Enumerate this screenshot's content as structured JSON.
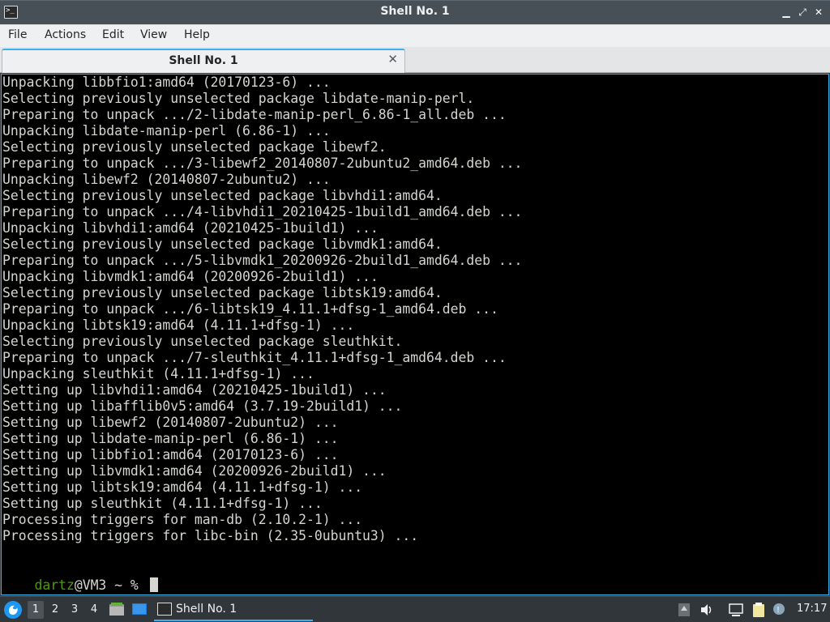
{
  "window": {
    "title": "Shell No. 1",
    "controls": {
      "minimize": "▁",
      "restore": "⤢",
      "close": "✕"
    }
  },
  "menubar": {
    "items": [
      "File",
      "Actions",
      "Edit",
      "View",
      "Help"
    ]
  },
  "tabs": [
    {
      "label": "Shell No. 1",
      "close": "✕"
    }
  ],
  "terminal": {
    "lines": [
      "Unpacking libbfio1:amd64 (20170123-6) ...",
      "Selecting previously unselected package libdate-manip-perl.",
      "Preparing to unpack .../2-libdate-manip-perl_6.86-1_all.deb ...",
      "Unpacking libdate-manip-perl (6.86-1) ...",
      "Selecting previously unselected package libewf2.",
      "Preparing to unpack .../3-libewf2_20140807-2ubuntu2_amd64.deb ...",
      "Unpacking libewf2 (20140807-2ubuntu2) ...",
      "Selecting previously unselected package libvhdi1:amd64.",
      "Preparing to unpack .../4-libvhdi1_20210425-1build1_amd64.deb ...",
      "Unpacking libvhdi1:amd64 (20210425-1build1) ...",
      "Selecting previously unselected package libvmdk1:amd64.",
      "Preparing to unpack .../5-libvmdk1_20200926-2build1_amd64.deb ...",
      "Unpacking libvmdk1:amd64 (20200926-2build1) ...",
      "Selecting previously unselected package libtsk19:amd64.",
      "Preparing to unpack .../6-libtsk19_4.11.1+dfsg-1_amd64.deb ...",
      "Unpacking libtsk19:amd64 (4.11.1+dfsg-1) ...",
      "Selecting previously unselected package sleuthkit.",
      "Preparing to unpack .../7-sleuthkit_4.11.1+dfsg-1_amd64.deb ...",
      "Unpacking sleuthkit (4.11.1+dfsg-1) ...",
      "Setting up libvhdi1:amd64 (20210425-1build1) ...",
      "Setting up libafflib0v5:amd64 (3.7.19-2build1) ...",
      "Setting up libewf2 (20140807-2ubuntu2) ...",
      "Setting up libdate-manip-perl (6.86-1) ...",
      "Setting up libbfio1:amd64 (20170123-6) ...",
      "Setting up libvmdk1:amd64 (20200926-2build1) ...",
      "Setting up libtsk19:amd64 (4.11.1+dfsg-1) ...",
      "Setting up sleuthkit (4.11.1+dfsg-1) ...",
      "Processing triggers for man-db (2.10.2-1) ...",
      "Processing triggers for libc-bin (2.35-0ubuntu3) ..."
    ],
    "prompt": {
      "user": "dartz",
      "rest": "@VM3 ~ % "
    },
    "colors": {
      "background": "#000000",
      "text": "#d3d7cf",
      "user": "#4e9a06"
    }
  },
  "taskbar": {
    "workspaces": [
      "1",
      "2",
      "3",
      "4"
    ],
    "active_workspace": "1",
    "task_label": "Shell No. 1",
    "clock": "17:17",
    "accent": "#3daee9"
  }
}
